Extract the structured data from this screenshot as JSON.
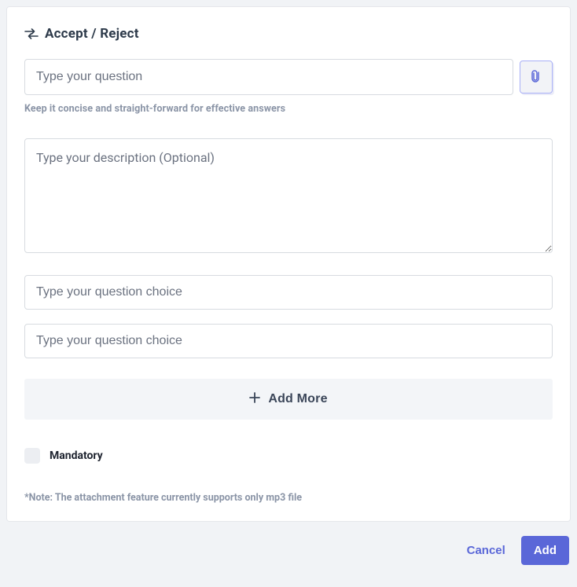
{
  "header": {
    "title": "Accept / Reject"
  },
  "question": {
    "placeholder": "Type your question",
    "hint": "Keep it concise and straight-forward for effective answers"
  },
  "description": {
    "placeholder": "Type your description (Optional)"
  },
  "choices": [
    {
      "placeholder": "Type your question choice"
    },
    {
      "placeholder": "Type your question choice"
    }
  ],
  "add_more_label": "Add More",
  "mandatory": {
    "label": "Mandatory",
    "checked": false
  },
  "note": "*Note: The attachment feature currently supports only mp3 file",
  "footer": {
    "cancel": "Cancel",
    "add": "Add"
  }
}
